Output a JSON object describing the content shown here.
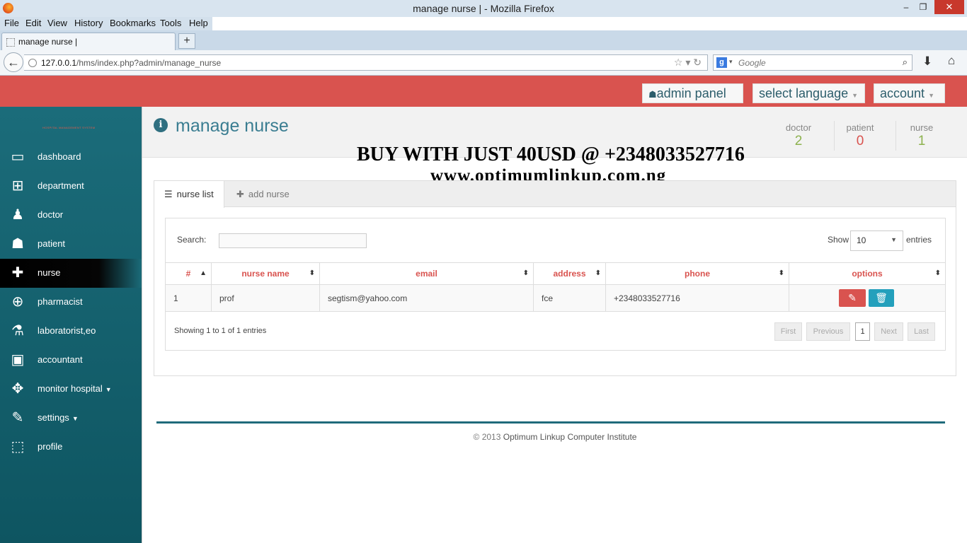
{
  "window": {
    "title": "manage nurse | - Mozilla Firefox",
    "minimize": "–",
    "maximize": "❐",
    "close": "✕"
  },
  "menu": [
    "File",
    "Edit",
    "View",
    "History",
    "Bookmarks",
    "Tools",
    "Help"
  ],
  "tab": {
    "label": "manage nurse |",
    "new_tab": "+"
  },
  "url": {
    "host": "127.0.0.1",
    "path": "/hms/index.php?admin/manage_nurse"
  },
  "search": {
    "engine": "g",
    "placeholder": "Google"
  },
  "header": {
    "admin_panel": "admin panel",
    "select_language": "select language",
    "account": "account"
  },
  "sidebar": {
    "brand": "HOSPITAL MANAGEMENT SYSTEM",
    "items": [
      {
        "label": "dashboard",
        "icon": "monitor-icon",
        "glyph": "▭"
      },
      {
        "label": "department",
        "icon": "sitemap-icon",
        "glyph": "⊞"
      },
      {
        "label": "doctor",
        "icon": "user-md-icon",
        "glyph": "♟"
      },
      {
        "label": "patient",
        "icon": "user-icon",
        "glyph": "☗"
      },
      {
        "label": "nurse",
        "icon": "plus-square-icon",
        "glyph": "✚"
      },
      {
        "label": "pharmacist",
        "icon": "medkit-icon",
        "glyph": "⊕"
      },
      {
        "label": "laboratorist,eo",
        "icon": "beaker-icon",
        "glyph": "⚗"
      },
      {
        "label": "accountant",
        "icon": "money-icon",
        "glyph": "▣"
      },
      {
        "label": "monitor hospital",
        "icon": "move-icon",
        "glyph": "✥"
      },
      {
        "label": "settings",
        "icon": "wrench-icon",
        "glyph": "✎"
      },
      {
        "label": "profile",
        "icon": "lock-icon",
        "glyph": "⬚"
      }
    ],
    "active_index": 4
  },
  "page": {
    "title": "manage nurse",
    "stats": [
      {
        "label": "doctor",
        "value": "2",
        "color": "#8db24e"
      },
      {
        "label": "patient",
        "value": "0",
        "color": "#d9534f"
      },
      {
        "label": "nurse",
        "value": "1",
        "color": "#8db24e"
      }
    ]
  },
  "promo": {
    "line1": "BUY WITH JUST 40USD @ +2348033527716",
    "line2": "www.optimumlinkup.com.ng"
  },
  "panel": {
    "tabs": [
      {
        "label": "nurse list",
        "icon": "list-icon"
      },
      {
        "label": "add nurse",
        "icon": "plus-icon"
      }
    ],
    "search_label": "Search:",
    "show_label": "Show",
    "page_length": "10",
    "entries_label": "entries",
    "columns": [
      "#",
      "nurse name",
      "email",
      "address",
      "phone",
      "options"
    ],
    "rows": [
      {
        "num": "1",
        "name": "prof",
        "email": "segtism@yahoo.com",
        "address": "fce",
        "phone": "+2348033527716"
      }
    ],
    "info": "Showing 1 to 1 of 1 entries",
    "pagination": {
      "first": "First",
      "previous": "Previous",
      "current": "1",
      "next": "Next",
      "last": "Last"
    }
  },
  "footer": {
    "prefix": "© 2013",
    "org": "Optimum Linkup Computer Institute"
  },
  "colors": {
    "accent_red": "#d9534f",
    "teal": "#1b6c7a",
    "info_blue": "#24a0bc"
  }
}
